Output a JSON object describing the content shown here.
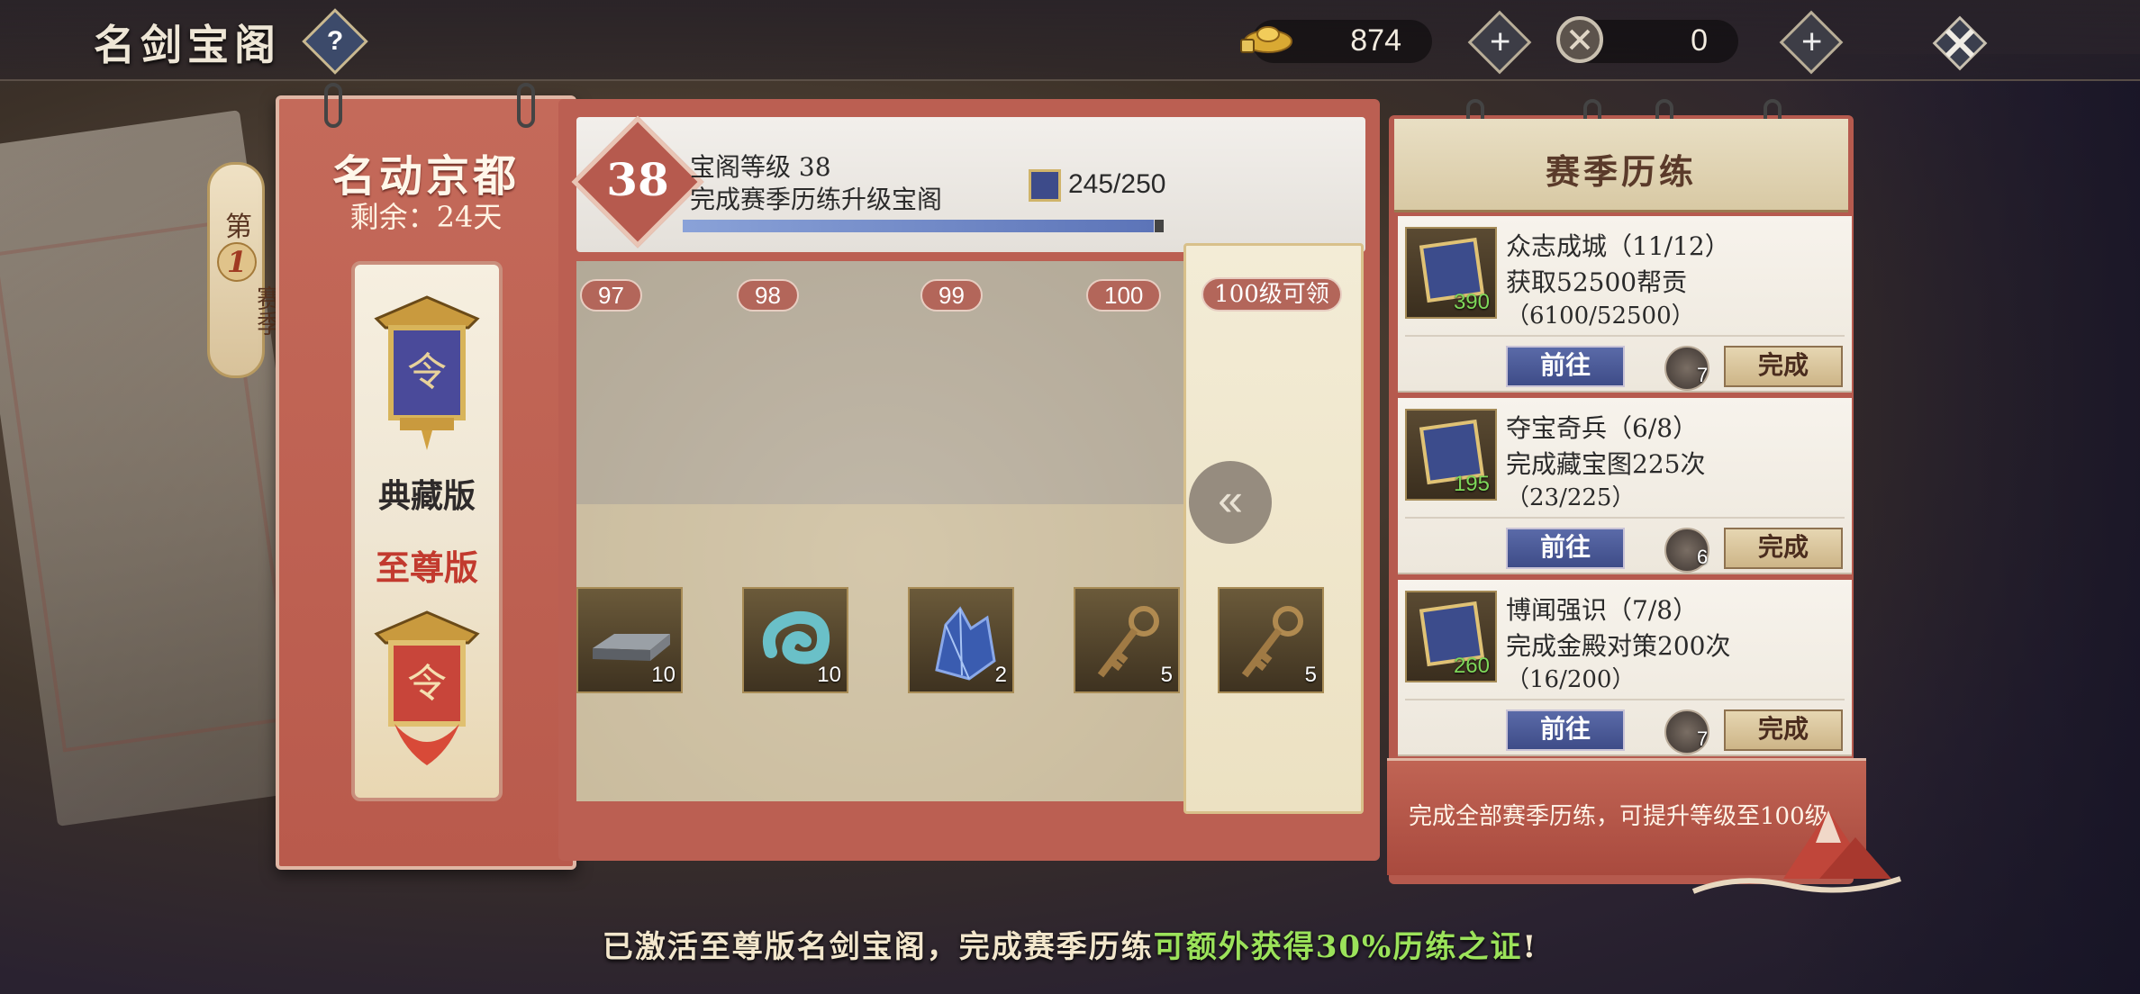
{
  "header": {
    "title": "名剑宝阁",
    "help_label": "?",
    "currency_gold": "874",
    "currency_token": "0",
    "plus_label": "+"
  },
  "season": {
    "prefix": "第",
    "number": "1",
    "suffix": "赛季"
  },
  "season_card": {
    "title": "名动京都",
    "remaining": "剩余：24天",
    "edition_basic": "典藏版",
    "edition_premium": "至尊版"
  },
  "level": {
    "number": "38",
    "title": "宝阁等级 38",
    "subtitle": "完成赛季历练升级宝阁",
    "xp_text": "245/250",
    "progress": 0.98
  },
  "track": {
    "markers": [
      "97",
      "98",
      "99",
      "100"
    ],
    "goal_label": "100级可领",
    "collapse_label": "«",
    "rewards": [
      {
        "item": "silver-ingot",
        "count": "10"
      },
      {
        "item": "jade-swirl",
        "count": "10"
      },
      {
        "item": "blue-crystal",
        "count": "2"
      },
      {
        "item": "bronze-key",
        "count": "5"
      },
      {
        "item": "bronze-key",
        "count": "5"
      }
    ]
  },
  "season_tasks": {
    "title": "赛季历练",
    "go_label": "前往",
    "done_label": "完成",
    "items": [
      {
        "name": "众志成城（11/12）",
        "desc": "获取52500帮贡",
        "progress": "（6100/52500）",
        "xp": "390",
        "coin": "7"
      },
      {
        "name": "夺宝奇兵（6/8）",
        "desc": "完成藏宝图225次",
        "progress": "（23/225）",
        "xp": "195",
        "coin": "6"
      },
      {
        "name": "博闻强识（7/8）",
        "desc": "完成金殿对策200次",
        "progress": "（16/200）",
        "xp": "260",
        "coin": "7"
      }
    ],
    "hint": "完成全部赛季历练，可提升等级至100级"
  },
  "notice": {
    "part1": "已激活至尊版名剑宝阁，完成赛季历练",
    "highlight": "可额外获得30%历练之证",
    "part2": "!"
  },
  "colors": {
    "panel_red": "#b95a4c",
    "highlight_green": "#9be25a",
    "button_blue": "#3e4c88"
  }
}
